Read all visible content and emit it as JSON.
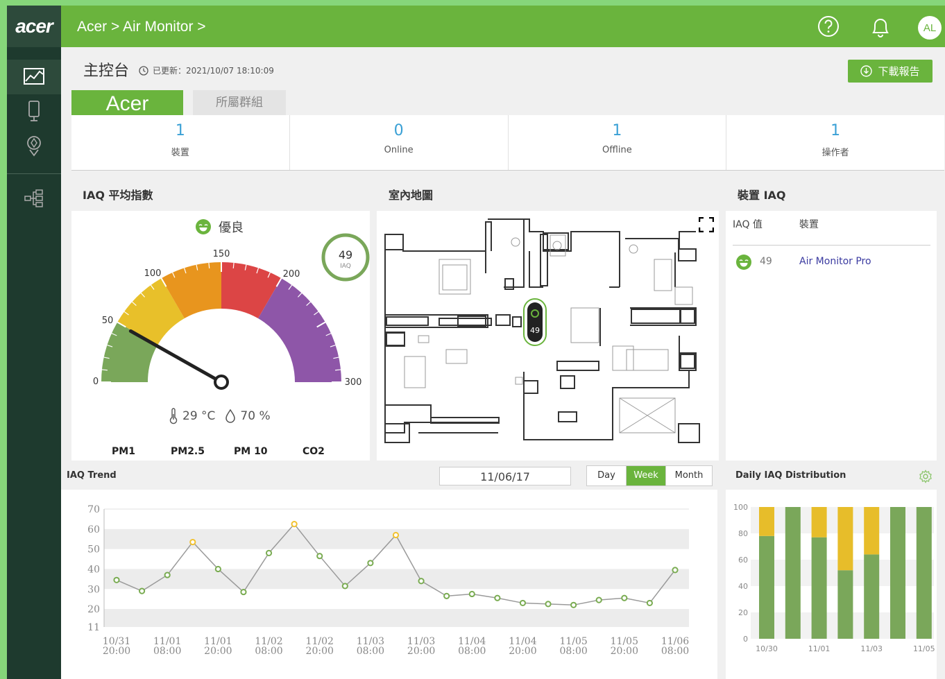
{
  "brand": {
    "logo": "acer"
  },
  "header": {
    "breadcrumb": "Acer > Air Monitor >",
    "avatar": "AL"
  },
  "page": {
    "title": "主控台",
    "updated": "已更新：2021/10/07 18:10:09",
    "download_label": "下載報告"
  },
  "tabs": [
    {
      "label": "Acer"
    },
    {
      "label": "所屬群組"
    }
  ],
  "stats": [
    {
      "value": "1",
      "label": "裝置"
    },
    {
      "value": "0",
      "label": "Online"
    },
    {
      "value": "1",
      "label": "Offline"
    },
    {
      "value": "1",
      "label": "操作者"
    }
  ],
  "iaq_avg": {
    "title": "IAQ 平均指數",
    "status": "優良",
    "value": 49,
    "value_label": "49",
    "unit": "IAQ",
    "gauge_ticks": [
      "0",
      "50",
      "100",
      "150",
      "200",
      "300"
    ],
    "temperature": "29 °C",
    "humidity": "70 %",
    "metrics": [
      "PM1",
      "PM2.5",
      "PM 10",
      "CO2"
    ]
  },
  "map": {
    "title": "室內地圖",
    "marker_value": "49"
  },
  "device_iaq": {
    "title": "裝置 IAQ",
    "col_iaq": "IAQ 值",
    "col_device": "裝置",
    "rows": [
      {
        "iaq": "49",
        "device": "Air Monitor Pro"
      }
    ]
  },
  "trend": {
    "title": "IAQ Trend",
    "date": "11/06/17",
    "ranges": [
      "Day",
      "Week",
      "Month"
    ],
    "selected_range": "Week"
  },
  "distribution": {
    "title": "Daily IAQ Distribution"
  },
  "chart_data": [
    {
      "type": "line",
      "title": "IAQ Trend",
      "ylim": [
        11,
        70
      ],
      "y_ticks": [
        "70",
        "60",
        "50",
        "40",
        "30",
        "20",
        "11"
      ],
      "x_ticks": [
        [
          "10/31",
          "20:00"
        ],
        [
          "11/01",
          "08:00"
        ],
        [
          "11/01",
          "20:00"
        ],
        [
          "11/02",
          "08:00"
        ],
        [
          "11/02",
          "20:00"
        ],
        [
          "11/03",
          "08:00"
        ],
        [
          "11/03",
          "20:00"
        ],
        [
          "11/04",
          "08:00"
        ],
        [
          "11/04",
          "20:00"
        ],
        [
          "11/05",
          "08:00"
        ],
        [
          "11/05",
          "20:00"
        ],
        [
          "11/06",
          "08:00"
        ]
      ],
      "values": [
        34.5,
        29,
        37,
        53.5,
        40,
        28.5,
        48,
        62.5,
        46.5,
        31.5,
        43,
        57,
        34,
        26.5,
        27.5,
        25.5,
        23,
        22.5,
        22,
        24.5,
        25.5,
        23,
        39.5
      ],
      "highlight_color": "#f2c230",
      "point_color": "#7aac52",
      "grid": true
    },
    {
      "type": "bar",
      "stacked": true,
      "title": "Daily IAQ Distribution",
      "ylim": [
        0,
        100
      ],
      "y_ticks": [
        "100",
        "80",
        "60",
        "40",
        "20",
        "0"
      ],
      "x_ticks": [
        "10/30",
        "11/01",
        "11/03",
        "11/05"
      ],
      "series": [
        {
          "values": [
            78,
            100,
            77,
            52,
            64,
            100,
            100
          ],
          "color": "#7aa75a"
        },
        {
          "values": [
            22,
            0,
            23,
            48,
            36,
            0,
            0
          ],
          "color": "#e7bd2a"
        }
      ]
    }
  ]
}
